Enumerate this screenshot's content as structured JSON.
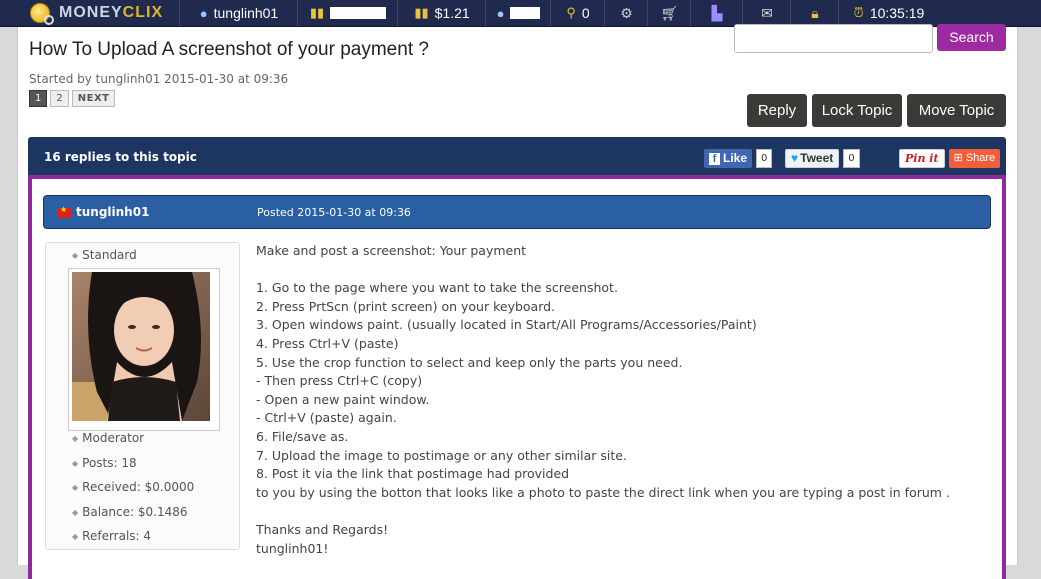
{
  "topbar": {
    "logo_part1": "MONEY",
    "logo_part2": "CLIX",
    "username": "tunglinh01",
    "balance": "$1.21",
    "cart_count": "0",
    "time": "10:35:19",
    "items_hidden_value": "466"
  },
  "search": {
    "button": "Search",
    "placeholder": ""
  },
  "topic": {
    "title": "How To Upload A screenshot of your payment ?",
    "started_by": "Started by tunglinh01 2015-01-30 at 09:36",
    "pages": [
      "1",
      "2"
    ],
    "next_label": "NEXT",
    "reply_button": "Reply",
    "lock_button": "Lock Topic",
    "move_button": "Move Topic",
    "replies_text": "16 replies to this topic"
  },
  "share": {
    "fb_label": "Like",
    "fb_count": "0",
    "tweet_label": "Tweet",
    "tweet_count": "0",
    "pin_label": "Pin it",
    "share_label": "Share"
  },
  "post": {
    "author": "tunglinh01",
    "posted": "Posted 2015-01-30 at 09:36",
    "rank_top": "Standard",
    "rank": "Moderator",
    "posts": "Posts: 18",
    "received": "Received: $0.0000",
    "balance": "Balance: $0.1486",
    "referrals": "Referrals: 4",
    "body": [
      "Make and post a screenshot: Your payment",
      "",
      "1. Go to the page where you want to take the screenshot.",
      "2. Press PrtScn (print screen) on your keyboard.",
      "3. Open windows paint. (usually located in Start/All Programs/Accessories/Paint)",
      "4. Press Ctrl+V (paste)",
      "5. Use the crop function to select and keep only the parts you need.",
      "- Then press Ctrl+C (copy)",
      "- Open a new paint window.",
      "- Ctrl+V (paste) again.",
      "6. File/save as.",
      "7. Upload the image to postimage or any other similar site.",
      "8. Post it via the link that postimage had provided",
      "to you by using the botton that looks like a photo to paste the direct link when you are typing a post in forum .",
      "",
      "Thanks and Regards!",
      "tunglinh01!"
    ]
  },
  "colors": {
    "topbar": "#1f2a4e",
    "search_button": "#9e2aa2",
    "topic_header": "#1d3561",
    "post_header": "#2a5fa3",
    "post_border": "#8e2a9a"
  }
}
